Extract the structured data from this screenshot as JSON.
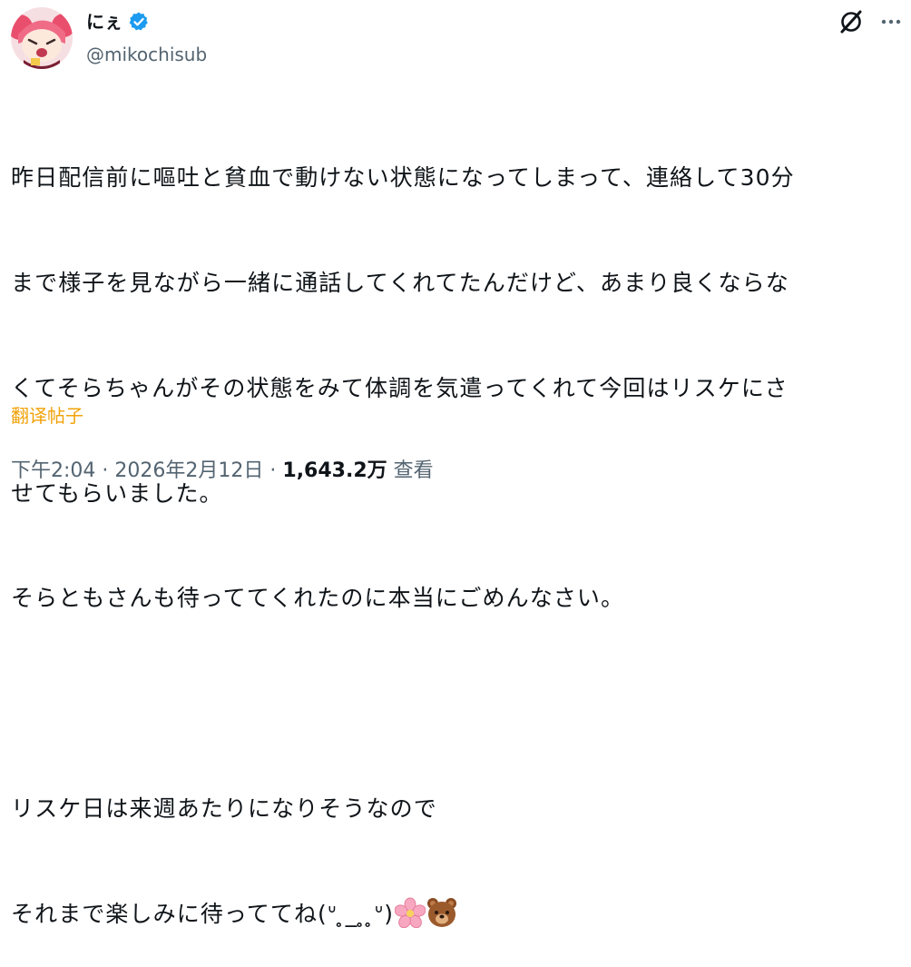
{
  "author": {
    "display_name": "にぇ",
    "handle": "@mikochisub",
    "verified": true
  },
  "icons": {
    "verified": "verified-badge-icon",
    "grok": "grok-icon",
    "more": "more-options-icon",
    "emoji_1": "cherry-blossom-emoji",
    "emoji_2": "bear-face-emoji"
  },
  "tweet": {
    "lines": [
      "昨日配信前に嘔吐と貧血で動けない状態になってしまって、連絡して30分",
      "まで様子を見ながら一緒に通話してくれてたんだけど、あまり良くならな",
      "くてそらちゃんがその状態をみて体調を気遣ってくれて今回はリスケにさ",
      "せてもらいました。",
      "そらともさんも待っててくれたのに本当にごめんなさい。",
      "",
      "リスケ日は来週あたりになりそうなので",
      "それまで楽しみに待っててね(ᐡ ̥_ ̥ ̥ᐡ)"
    ],
    "translate_label": "翻译帖子"
  },
  "meta": {
    "time": "下午2:04",
    "separator": "·",
    "date": "2026年2月12日",
    "views_count": "1,643.2万",
    "views_label": "查看"
  },
  "colors": {
    "text": "#0f1419",
    "secondary": "#536471",
    "translate": "#f2a20a",
    "verified": "#1d9bf0"
  }
}
